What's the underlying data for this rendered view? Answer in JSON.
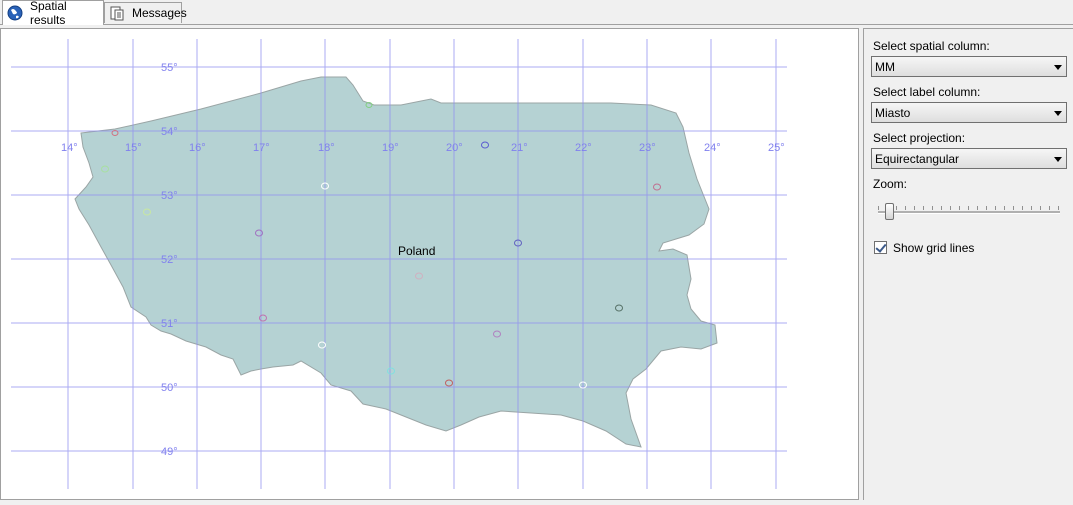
{
  "tabs": [
    {
      "label": "Spatial results",
      "icon": "globe-icon",
      "active": true
    },
    {
      "label": "Messages",
      "icon": "messages-icon",
      "active": false
    }
  ],
  "map": {
    "country_label": "Poland",
    "lon_labels": [
      "14°",
      "15°",
      "16°",
      "17°",
      "18°",
      "19°",
      "20°",
      "21°",
      "22°",
      "23°",
      "24°",
      "25°"
    ],
    "lat_labels": [
      "55°",
      "54°",
      "53°",
      "52°",
      "51°",
      "50°",
      "49°"
    ],
    "colors": {
      "land": "#b5d2d3",
      "border": "#9aa5a5",
      "grid": "#8080ee"
    }
  },
  "options": {
    "spatial_column_label": "Select spatial column:",
    "spatial_column_value": "MM",
    "label_column_label": "Select label column:",
    "label_column_value": "Miasto",
    "projection_label": "Select projection:",
    "projection_value": "Equirectangular",
    "zoom_label": "Zoom:",
    "zoom_level": 0.05,
    "show_grid_label": "Show grid lines",
    "show_grid_checked": true
  }
}
